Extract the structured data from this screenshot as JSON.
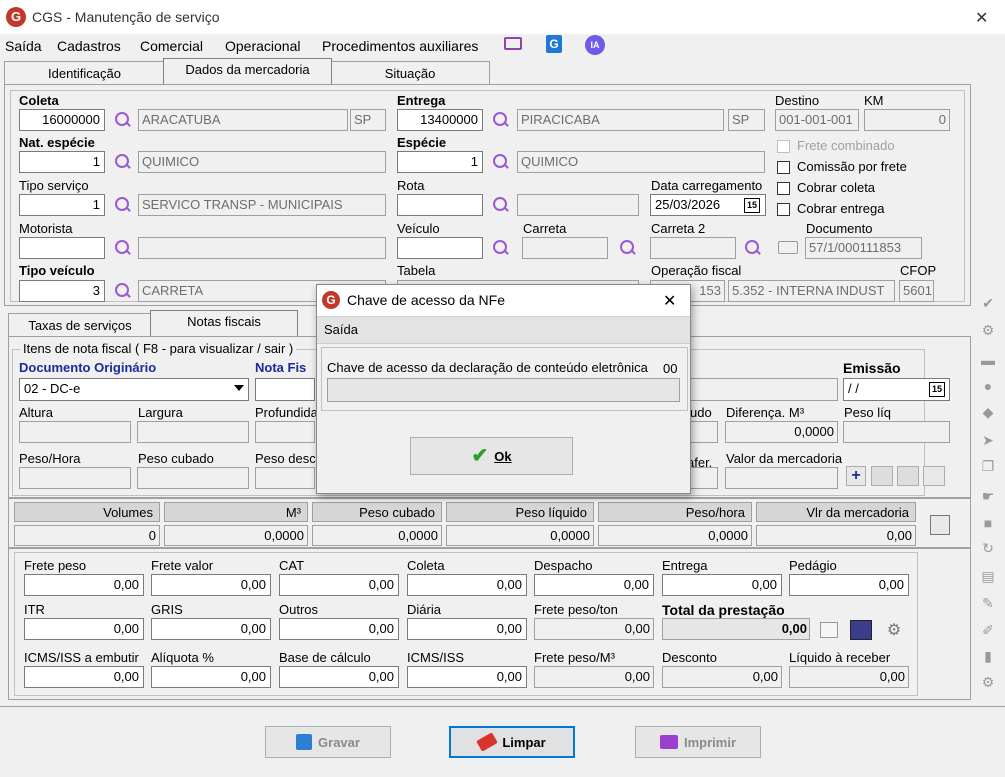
{
  "window": {
    "title": "CGS - Manutenção de serviço",
    "close": "✕"
  },
  "menu": [
    "Saída",
    "Cadastros",
    "Comercial",
    "Operacional",
    "Procedimentos auxiliares"
  ],
  "menu_icons": {
    "ia": "IA"
  },
  "tabs": [
    "Identificação",
    "Dados da mercadoria",
    "Situação"
  ],
  "coleta": {
    "label": "Coleta",
    "code": "16000000",
    "city": "ARACATUBA",
    "uf": "SP"
  },
  "entrega": {
    "label": "Entrega",
    "code": "13400000",
    "city": "PIRACICABA",
    "uf": "SP"
  },
  "destino": {
    "label": "Destino",
    "value": "001-001-001"
  },
  "km": {
    "label": "KM",
    "value": "0"
  },
  "nat_especie": {
    "label": "Nat. espécie",
    "code": "1",
    "desc": "QUIMICO"
  },
  "especie": {
    "label": "Espécie",
    "code": "1",
    "desc": "QUIMICO"
  },
  "checks": {
    "frete_combinado": "Frete combinado",
    "comissao": "Comissão por frete",
    "cobrar_coleta": "Cobrar coleta",
    "cobrar_entrega": "Cobrar entrega"
  },
  "tipo_servico": {
    "label": "Tipo serviço",
    "code": "1",
    "desc": "SERVICO TRANSP - MUNICIPAIS"
  },
  "rota": {
    "label": "Rota"
  },
  "data_carregamento": {
    "label": "Data carregamento",
    "value": "25/03/2026",
    "cal": "15"
  },
  "motorista": {
    "label": "Motorista"
  },
  "veiculo": {
    "label": "Veículo"
  },
  "carreta": {
    "label": "Carreta"
  },
  "carreta2": {
    "label": "Carreta 2"
  },
  "documento": {
    "label": "Documento",
    "value": "57/1/000111853"
  },
  "tipo_veiculo": {
    "label": "Tipo veículo",
    "code": "3",
    "desc": "CARRETA"
  },
  "tabela": {
    "label": "Tabela"
  },
  "operacao_fiscal": {
    "label": "Operação fiscal",
    "code": "153",
    "desc": "5.352 - INTERNA INDUST"
  },
  "cfop": {
    "label": "CFOP",
    "value": "5601"
  },
  "subtabs": [
    "Taxas de serviços",
    "Notas fiscais"
  ],
  "itens": {
    "legend": "Itens de nota fiscal ( F8 - para visualizar / sair )",
    "doc_orig_label": "Documento Originário",
    "doc_orig_value": "02 - DC-e",
    "nota_label": "Nota Fis",
    "emissao_label": "Emissão",
    "emissao_value": " / /",
    "cal": "15",
    "altura": "Altura",
    "largura": "Largura",
    "profundidade": "Profundida",
    "trunc_udo": "udo",
    "diferenca": "Diferença. M³",
    "diferenca_value": "0,0000",
    "peso_liq": "Peso líq",
    "peso_hora": "Peso/Hora",
    "peso_cubado": "Peso cubado",
    "peso_desc": "Peso desc",
    "trunc_afer": "afer.",
    "valor_merc": "Valor da mercadoria"
  },
  "totals": {
    "headers": [
      "Volumes",
      "M³",
      "Peso cubado",
      "Peso líquido",
      "Peso/hora",
      "Vlr da mercadoria"
    ],
    "values": [
      "0",
      "0,0000",
      "0,0000",
      "0,0000",
      "0,0000",
      "0,00"
    ]
  },
  "frete_rows": [
    [
      {
        "l": "Frete peso",
        "v": "0,00"
      },
      {
        "l": "Frete valor",
        "v": "0,00"
      },
      {
        "l": "CAT",
        "v": "0,00"
      },
      {
        "l": "Coleta",
        "v": "0,00"
      },
      {
        "l": "Despacho",
        "v": "0,00"
      },
      {
        "l": "Entrega",
        "v": "0,00"
      },
      {
        "l": "Pedágio",
        "v": "0,00"
      }
    ],
    [
      {
        "l": "ITR",
        "v": "0,00"
      },
      {
        "l": "GRIS",
        "v": "0,00"
      },
      {
        "l": "Outros",
        "v": "0,00"
      },
      {
        "l": "Diária",
        "v": "0,00"
      },
      {
        "l": "Frete peso/ton",
        "v": "0,00"
      },
      {
        "l": "Total da prestação",
        "v": "0,00"
      }
    ],
    [
      {
        "l": "ICMS/ISS a embutir",
        "v": "0,00"
      },
      {
        "l": "Alíquota %",
        "v": "0,00"
      },
      {
        "l": "Base de cálculo",
        "v": "0,00"
      },
      {
        "l": "ICMS/ISS",
        "v": "0,00"
      },
      {
        "l": "Frete peso/M³",
        "v": "0,00"
      },
      {
        "l": "Desconto",
        "v": "0,00"
      },
      {
        "l": "Líquido à receber",
        "v": "0,00"
      }
    ]
  ],
  "buttons": {
    "gravar": "Gravar",
    "limpar": "Limpar",
    "imprimir": "Imprimir"
  },
  "dialog": {
    "title": "Chave de acesso da NFe",
    "close": "✕",
    "section": "Saída",
    "label": "Chave de acesso da declaração de conteúdo eletrônica",
    "counter": "00",
    "ok": "Ok"
  },
  "colors": {
    "accent_purple": "#9b59d0",
    "logo_red": "#c0392b",
    "dialog_bg": "#f0f0f0"
  }
}
